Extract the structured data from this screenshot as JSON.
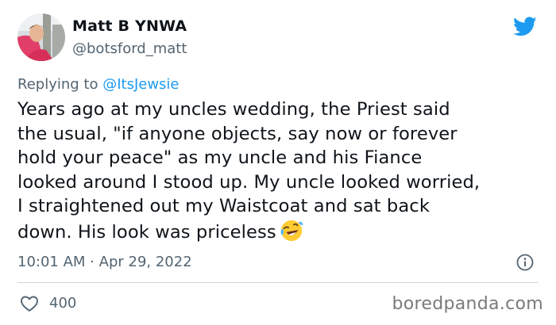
{
  "author": {
    "name": "Matt B YNWA",
    "handle": "@botsford_matt"
  },
  "reply": {
    "prefix": "Replying to ",
    "to": "@ItsJewsie"
  },
  "tweet": {
    "text": "Years ago at my uncles wedding, the Priest said\nthe usual, \"if anyone objects, say now or forever\nhold your peace\" as my uncle and his Fiance\nlooked around I stood up. My uncle looked worried,\nI straightened out my Waistcoat and sat back\ndown. His look was priceless",
    "emoji": "rolling-on-floor-laughing"
  },
  "meta": {
    "time": "10:01 AM",
    "separator": " · ",
    "date": "Apr 29, 2022"
  },
  "stats": {
    "likes": "400"
  },
  "watermark": "boredpanda.com",
  "icons": {
    "brand": "twitter-bird-icon",
    "info": "info-icon",
    "like": "heart-icon"
  },
  "colors": {
    "brand": "#1d9bf0",
    "text": "#0f1419",
    "secondary": "#536471"
  }
}
